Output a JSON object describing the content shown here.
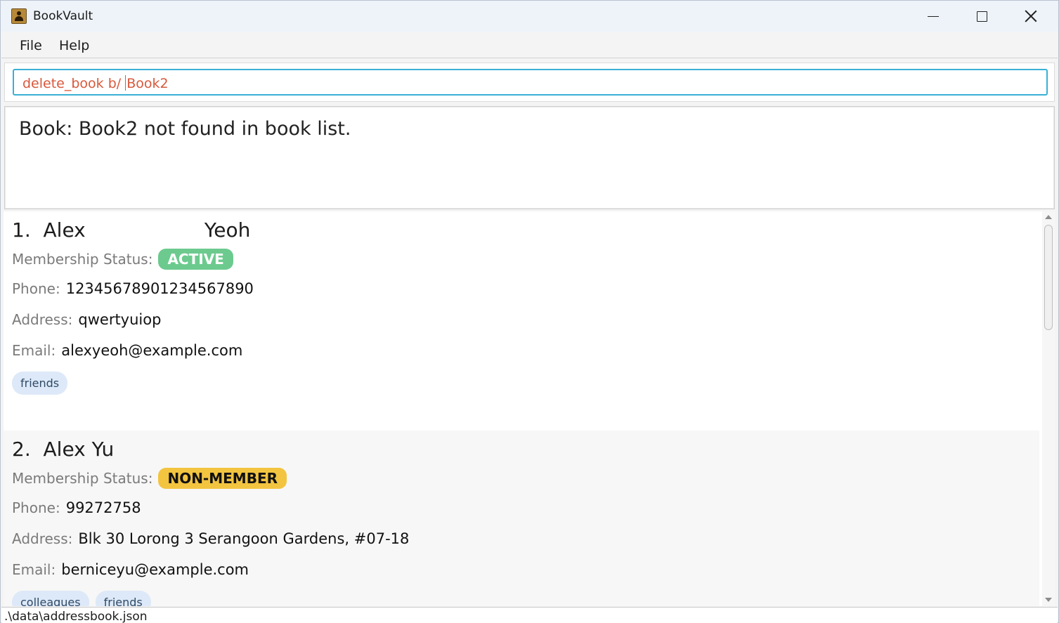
{
  "window": {
    "title": "BookVault",
    "icon": "app-book-icon"
  },
  "menu": {
    "items": [
      {
        "label": "File"
      },
      {
        "label": "Help"
      }
    ]
  },
  "command": {
    "before_caret": "delete_book b/ ",
    "after_caret": "Book2"
  },
  "result": {
    "message": "Book: Book2 not found in book list."
  },
  "persons": [
    {
      "name": "1.  Alex                   Yeoh",
      "status_label": "Membership Status:",
      "status": "ACTIVE",
      "phone_label": "Phone:",
      "phone": "12345678901234567890",
      "address_label": "Address:",
      "address": "qwertyuiop",
      "email_label": "Email:",
      "email": "alexyeoh@example.com",
      "tags": [
        "friends"
      ]
    },
    {
      "name": "2.  Alex Yu",
      "status_label": "Membership Status:",
      "status": "NON-MEMBER",
      "phone_label": "Phone:",
      "phone": "99272758",
      "address_label": "Address:",
      "address": "Blk 30 Lorong 3 Serangoon Gardens, #07-18",
      "email_label": "Email:",
      "email": "berniceyu@example.com",
      "tags": [
        "colleagues",
        "friends"
      ]
    }
  ],
  "status_bar": {
    "path": ".\\data\\addressbook.json"
  },
  "colors": {
    "active_badge": "#6cca8e",
    "non_member_badge": "#f2c440",
    "command_text": "#d9583b",
    "command_border": "#3ab0d6",
    "tag_background": "#dde9f8"
  }
}
